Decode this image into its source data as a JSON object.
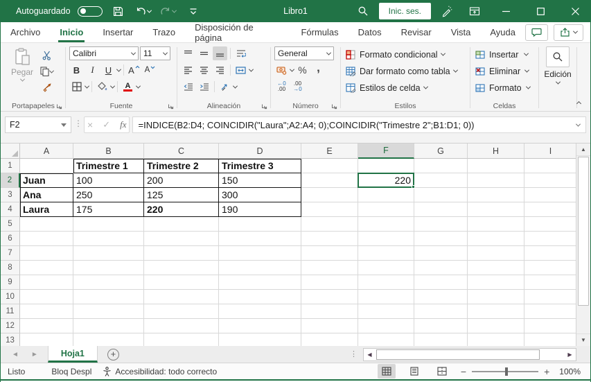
{
  "titlebar": {
    "autosave_label": "Autoguardado",
    "document_title": "Libro1",
    "signin_label": "Inic. ses.",
    "minimize": "─",
    "maximize": "",
    "close": "✕"
  },
  "tabs": {
    "items": [
      "Archivo",
      "Inicio",
      "Insertar",
      "Trazo",
      "Disposición de página",
      "Fórmulas",
      "Datos",
      "Revisar",
      "Vista",
      "Ayuda"
    ],
    "active": "Inicio"
  },
  "ribbon": {
    "portapapeles": {
      "label": "Portapapeles",
      "paste_label": "Pegar"
    },
    "fuente": {
      "label": "Fuente",
      "font_name": "Calibri",
      "font_size": "11",
      "bold": "B",
      "italic": "I",
      "underline": "U",
      "grow": "A",
      "shrink": "A"
    },
    "alineacion": {
      "label": "Alineación"
    },
    "numero": {
      "label": "Número",
      "format": "General",
      "percent": "%",
      "comma": ",",
      "inc_dec": "←0",
      "inc_dec2": ".00",
      "dec_dec": ".00",
      "dec_dec2": "→0"
    },
    "estilos": {
      "label": "Estilos",
      "items": [
        "Formato condicional",
        "Dar formato como tabla",
        "Estilos de celda"
      ]
    },
    "celdas": {
      "label": "Celdas",
      "items": [
        "Insertar",
        "Eliminar",
        "Formato"
      ]
    },
    "edicion": {
      "label": "Edición"
    }
  },
  "formula_bar": {
    "name_box": "F2",
    "fx": "fx",
    "cancel": "×",
    "enter": "✓",
    "formula": "=INDICE(B2:D4; COINCIDIR(\"Laura\";A2:A4; 0);COINCIDIR(\"Trimestre 2\";B1:D1; 0))"
  },
  "grid": {
    "columns": [
      "A",
      "B",
      "C",
      "D",
      "E",
      "F",
      "G",
      "H",
      "I"
    ],
    "row_count": 13,
    "selected_col": "F",
    "selected_row": 2,
    "cells": [
      {
        "ref": "B1",
        "text": "Trimestre 1",
        "bold": true,
        "borders": "tlrb"
      },
      {
        "ref": "C1",
        "text": "Trimestre 2",
        "bold": true,
        "borders": "trb"
      },
      {
        "ref": "D1",
        "text": "Trimestre 3",
        "bold": true,
        "borders": "trb"
      },
      {
        "ref": "A2",
        "text": "Juan",
        "bold": true,
        "borders": "tlrb"
      },
      {
        "ref": "B2",
        "text": "100",
        "borders": "rb"
      },
      {
        "ref": "C2",
        "text": "200",
        "borders": "rb"
      },
      {
        "ref": "D2",
        "text": "150",
        "borders": "rb"
      },
      {
        "ref": "A3",
        "text": "Ana",
        "bold": true,
        "borders": "lrb"
      },
      {
        "ref": "B3",
        "text": "250",
        "borders": "rb"
      },
      {
        "ref": "C3",
        "text": "125",
        "borders": "rb"
      },
      {
        "ref": "D3",
        "text": "300",
        "borders": "rb"
      },
      {
        "ref": "A4",
        "text": "Laura",
        "bold": true,
        "borders": "lrb"
      },
      {
        "ref": "B4",
        "text": "175",
        "borders": "rb"
      },
      {
        "ref": "C4",
        "text": "220",
        "bold": true,
        "borders": "rb"
      },
      {
        "ref": "D4",
        "text": "190",
        "borders": "rb"
      },
      {
        "ref": "F2",
        "text": "220",
        "align": "right"
      }
    ]
  },
  "sheet": {
    "active_tab": "Hoja1"
  },
  "status": {
    "mode": "Listo",
    "scroll_lock": "Bloq Despl",
    "accessibility": "Accesibilidad: todo correcto",
    "zoom": "100%"
  }
}
